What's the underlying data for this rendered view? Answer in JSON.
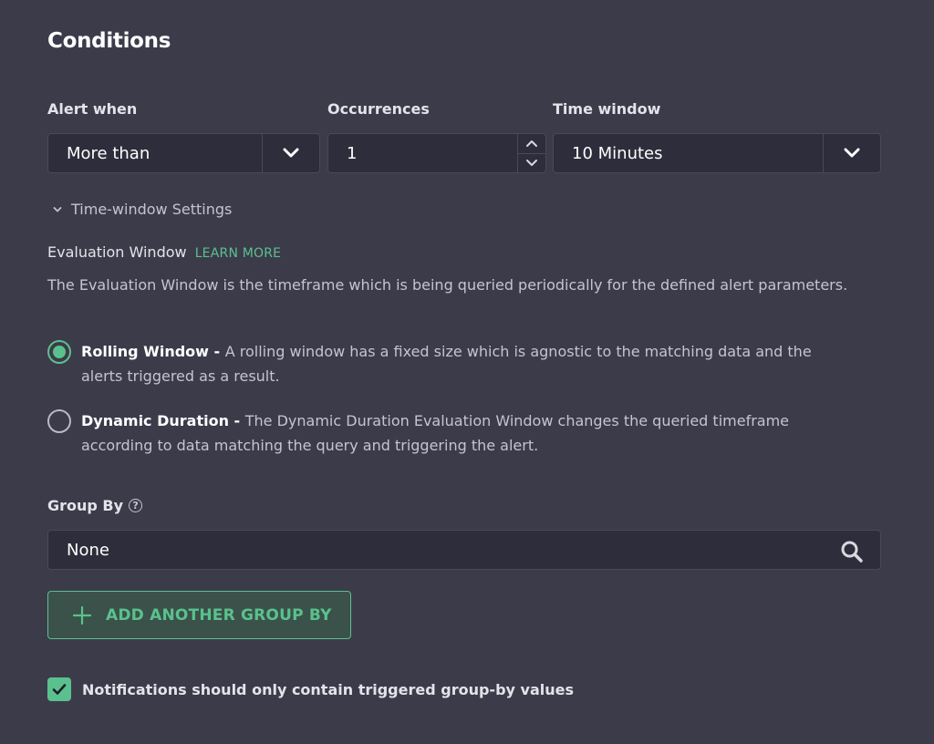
{
  "section": {
    "title": "Conditions"
  },
  "alert_when": {
    "label": "Alert when",
    "value": "More than",
    "icon": "chevron-down-icon"
  },
  "occurrences": {
    "label": "Occurrences",
    "value": "1"
  },
  "time_window": {
    "label": "Time window",
    "value": "10 Minutes",
    "icon": "chevron-down-icon"
  },
  "time_window_settings": {
    "label": "Time-window Settings",
    "expanded": true
  },
  "evaluation_window": {
    "title": "Evaluation Window",
    "learn_more": "LEARN MORE",
    "description": "The Evaluation Window is the timeframe which is being queried periodically for the defined alert parameters.",
    "options": [
      {
        "name": "Rolling Window",
        "separator": " - ",
        "description": "A rolling window has a fixed size which is agnostic to the matching data and the alerts triggered as a result.",
        "selected": true
      },
      {
        "name": "Dynamic Duration",
        "separator": " - ",
        "description": "The Dynamic Duration Evaluation Window changes the queried timeframe according to data matching the query and triggering the alert.",
        "selected": false
      }
    ]
  },
  "group_by": {
    "label": "Group By",
    "help_icon": "question-circle-icon",
    "value": "None",
    "search_icon": "search-icon",
    "add_button": "ADD ANOTHER GROUP BY"
  },
  "notifications_checkbox": {
    "label": "Notifications should only contain triggered group-by values",
    "checked": true
  },
  "colors": {
    "background": "#3c3b4a",
    "input_background": "#2e2d3b",
    "accent": "#5ac18e"
  }
}
